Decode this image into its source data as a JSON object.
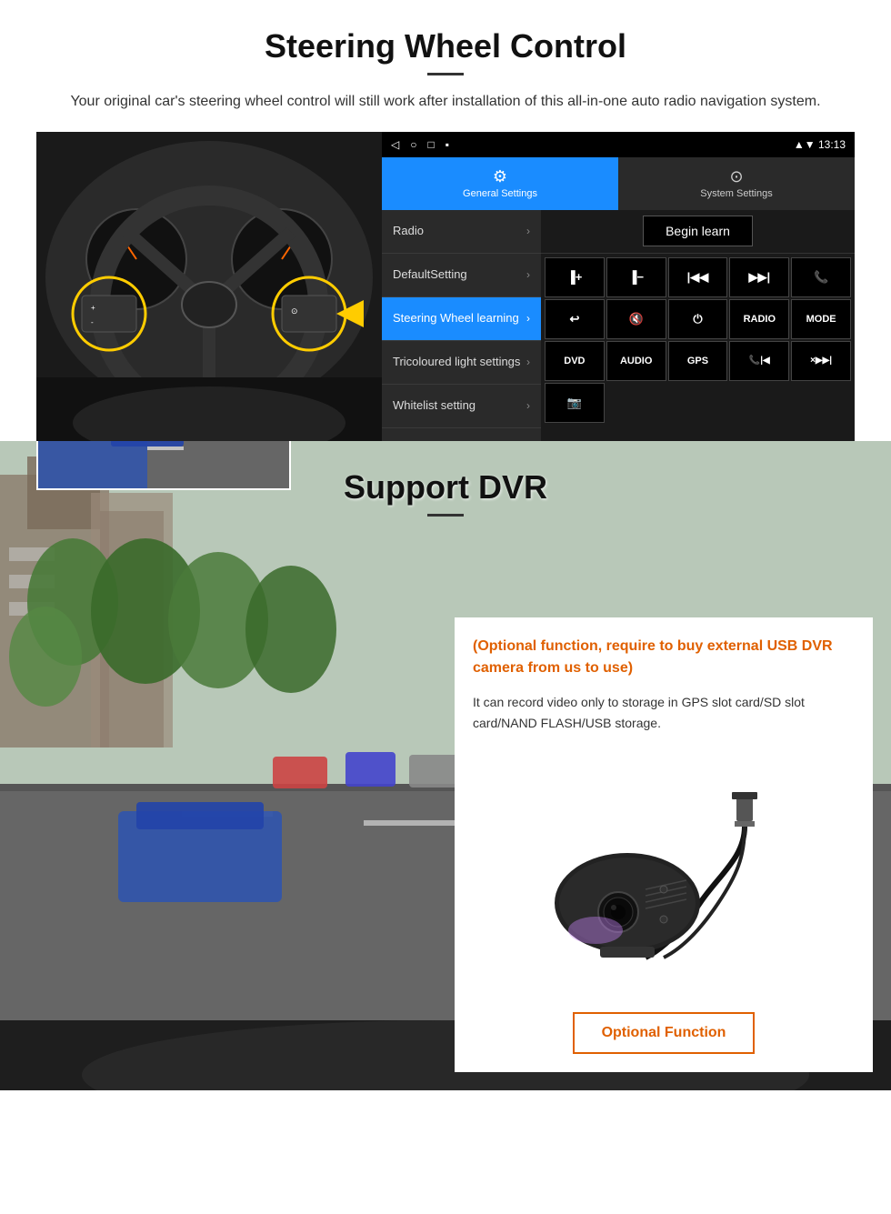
{
  "steering": {
    "title": "Steering Wheel Control",
    "description": "Your original car's steering wheel control will still work after installation of this all-in-one auto radio navigation system.",
    "statusbar": {
      "time": "13:13",
      "nav_icons": [
        "◁",
        "○",
        "□",
        "▪"
      ]
    },
    "tabs": {
      "general": "General Settings",
      "system": "System Settings"
    },
    "menu_items": [
      {
        "label": "Radio",
        "active": false
      },
      {
        "label": "DefaultSetting",
        "active": false
      },
      {
        "label": "Steering Wheel learning",
        "active": true
      },
      {
        "label": "Tricoloured light settings",
        "active": false
      },
      {
        "label": "Whitelist setting",
        "active": false
      }
    ],
    "begin_learn": "Begin learn",
    "controls": [
      "vol+",
      "vol-",
      "|◀◀",
      "▶▶|",
      "📞",
      "↩",
      "🔇×",
      "⏻",
      "RADIO",
      "MODE",
      "DVD",
      "AUDIO",
      "GPS",
      "📞|◀◀",
      "×▶▶|",
      "📷"
    ]
  },
  "dvr": {
    "title": "Support DVR",
    "optional_text": "(Optional function, require to buy external USB DVR camera from us to use)",
    "info_text": "It can record video only to storage in GPS slot card/SD slot card/NAND FLASH/USB storage.",
    "optional_function_btn": "Optional Function"
  }
}
